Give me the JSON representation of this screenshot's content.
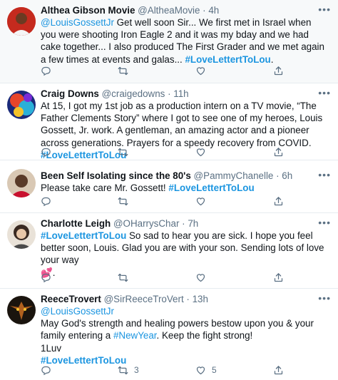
{
  "tweets": [
    {
      "name": "Althea Gibson Movie",
      "handle": "@AltheaMovie",
      "sep": " · ",
      "time": "4h",
      "mention": "@LouisGossettJr",
      "text": "  Get well soon Sir... We first met in Israel when you were shooting Iron Eagle 2 and it was my bday and we had cake together... I also produced The First Grader and we met again a few times at events and galas... ",
      "hashtag": "#LoveLettertToLou",
      "tail": ".",
      "replies": "",
      "retweets": "",
      "likes": ""
    },
    {
      "name": "Craig Downs",
      "handle": "@craigedowns",
      "sep": " · ",
      "time": "11h",
      "text": "At 15, I got my 1st job as a production intern on a TV movie, “The Father Clements Story” where I got to see one of my heroes, Louis Gossett, Jr. work. A gentleman, an amazing actor and a pioneer across generations. Prayers for a speedy recovery from COVID. ",
      "hashtag": "#LoveLettertToLou",
      "replies": "",
      "retweets": "",
      "likes": ""
    },
    {
      "name": "Been Self Isolating since the 80's",
      "handle": "@PammyChanelle",
      "sep": " · ",
      "time": "6h",
      "text": "Please take care Mr. Gossett!  ",
      "hashtag": "#LoveLettertToLou",
      "replies": "",
      "retweets": "",
      "likes": ""
    },
    {
      "name": "Charlotte Leigh",
      "handle": "@OHarrysChar",
      "sep": " · ",
      "time": "7h",
      "hashtag": "#LoveLettertToLou",
      "text": " So sad to hear you are sick.  I hope you feel better soon, Louis.  Glad you are with your son.  Sending lots of love your way ",
      "emoji": "💕",
      "tail": ".",
      "replies": "",
      "retweets": "",
      "likes": ""
    },
    {
      "name": "ReeceTrovert",
      "handle": "@SirReeceTroVert",
      "sep": " · ",
      "time": "13h",
      "mention": "@LouisGossettJr",
      "text": "May God's strength and healing powers bestow upon you & your family entering a ",
      "hashtag_inline": "#NewYear",
      "text2": ". Keep the fight strong!",
      "line3": "1Luv",
      "hashtag": "#LoveLettertToLou",
      "replies": "",
      "retweets": "3",
      "likes": "5"
    }
  ],
  "icons": {
    "reply": "reply-icon",
    "retweet": "retweet-icon",
    "like": "heart-icon",
    "share": "share-icon",
    "more": "more-icon"
  },
  "more_label": "•••",
  "colors": {
    "link": "#1b95e0",
    "muted": "#5b7083",
    "text": "#0f1419",
    "border": "#e6ecf0"
  }
}
